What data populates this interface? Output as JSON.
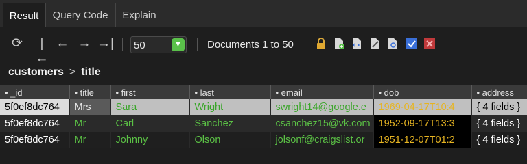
{
  "tabs": [
    {
      "label": "Result"
    },
    {
      "label": "Query Code"
    },
    {
      "label": "Explain"
    }
  ],
  "toolbar": {
    "page_size": "50",
    "doc_count": "Documents 1 to 50"
  },
  "breadcrumb": {
    "collection": "customers",
    "field": "title"
  },
  "table": {
    "columns": [
      "_id",
      "title",
      "first",
      "last",
      "email",
      "dob",
      "address"
    ],
    "rows": [
      {
        "id": "5f0ef8dc764",
        "title": "Mrs",
        "first": "Sara",
        "last": "Wright",
        "email": "swright14@google.e",
        "dob": "1969-04-17T10:4",
        "address": "{ 4 fields }"
      },
      {
        "id": "5f0ef8dc764",
        "title": "Mr",
        "first": "Carl",
        "last": "Sanchez",
        "email": "csanchez15@vk.com",
        "dob": "1952-09-17T13:3",
        "address": "{ 4 fields }"
      },
      {
        "id": "5f0ef8dc764",
        "title": "Mr",
        "first": "Johnny",
        "last": "Olson",
        "email": "jolsonf@craigslist.or",
        "dob": "1951-12-07T01:2",
        "address": "{ 4 fields }"
      }
    ]
  }
}
